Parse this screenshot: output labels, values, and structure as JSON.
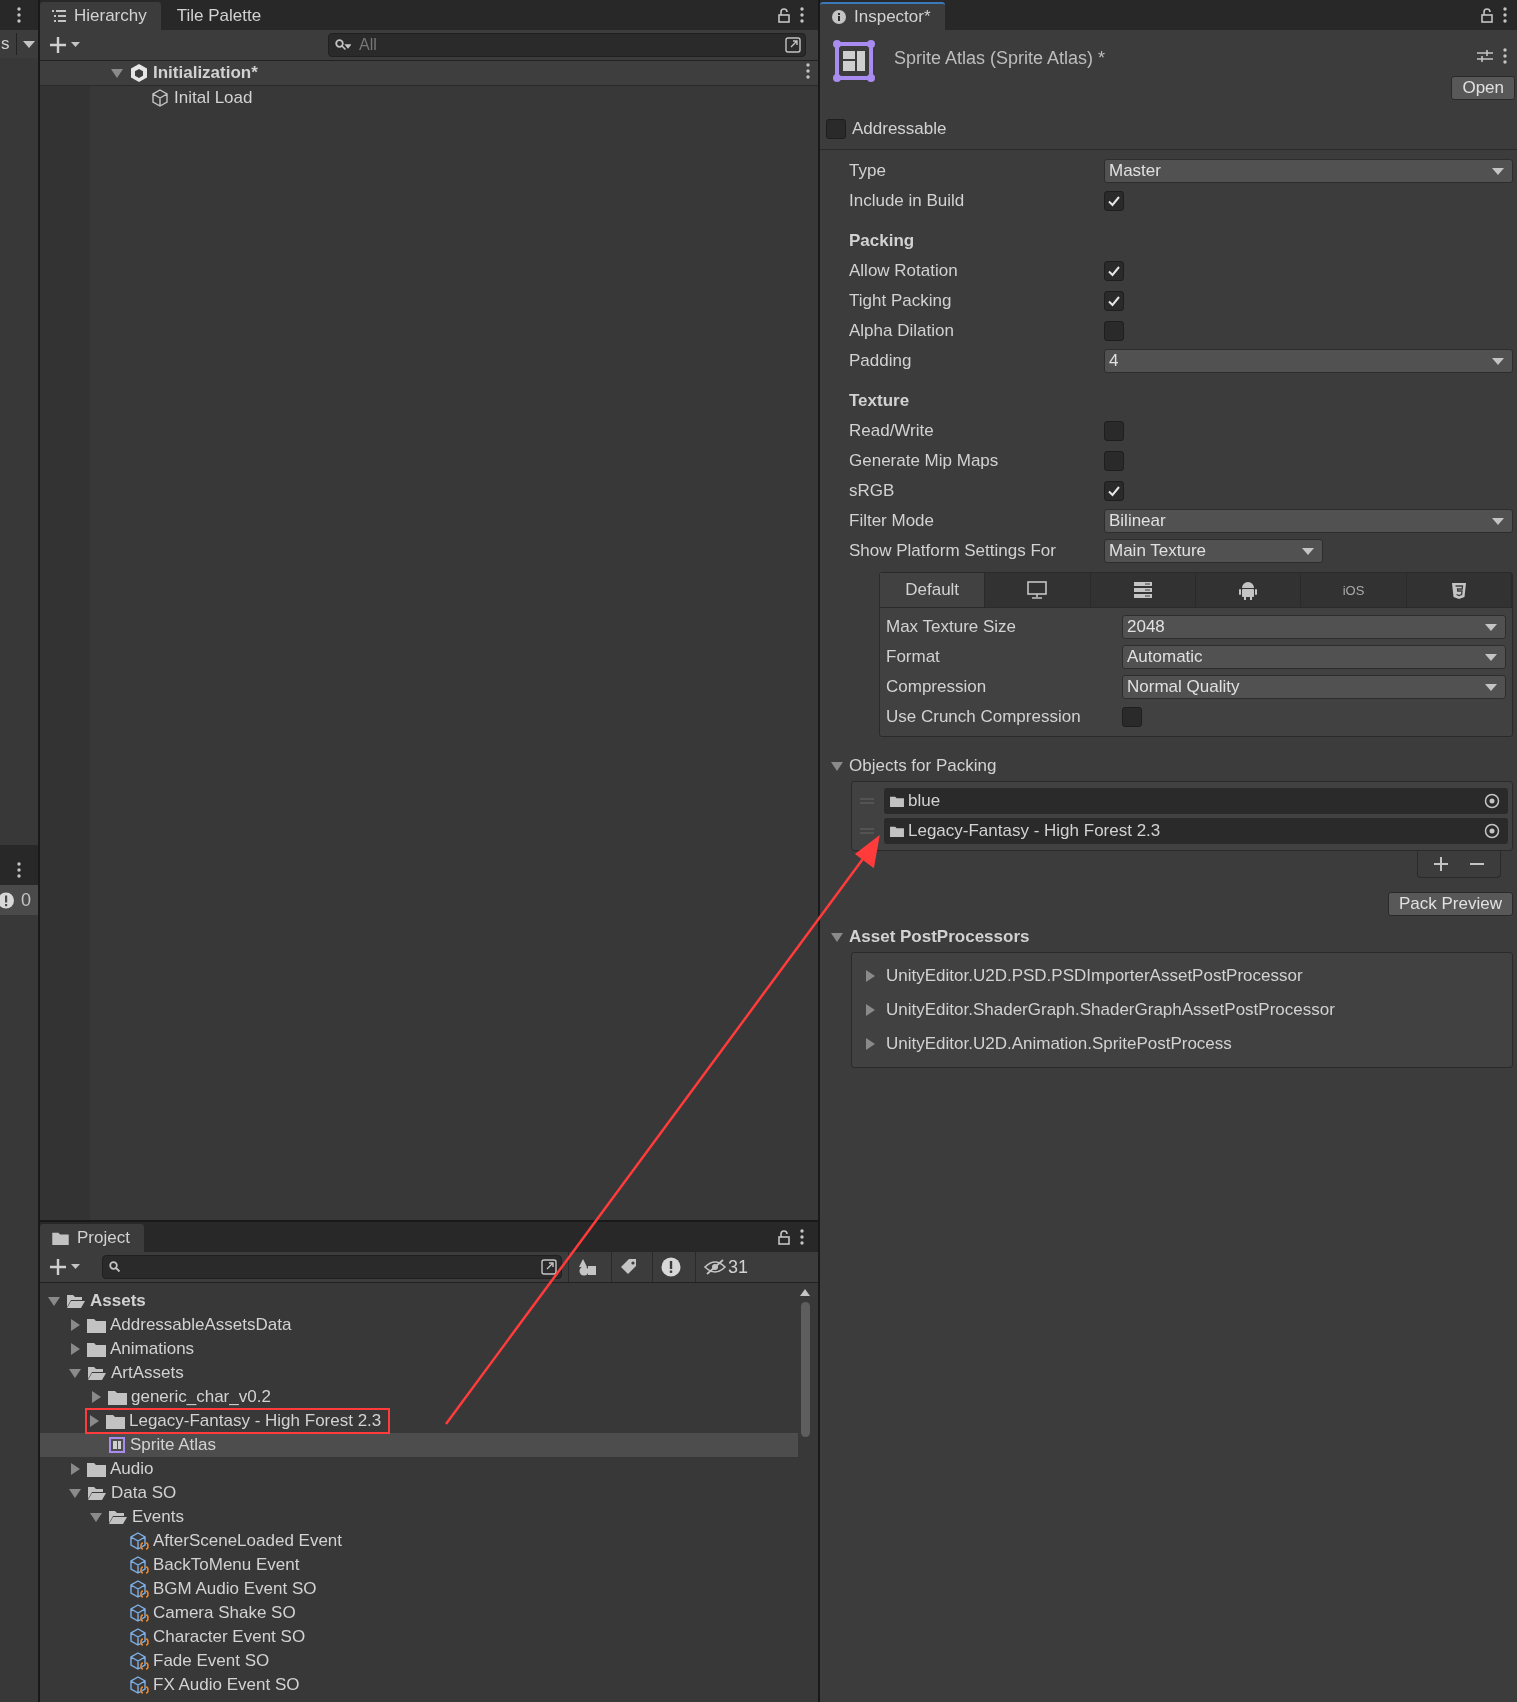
{
  "left_strip": {
    "toolbar_label": "s",
    "console_count": "0"
  },
  "hierarchy": {
    "tabs": [
      {
        "label": "Hierarchy",
        "selected": true
      },
      {
        "label": "Tile Palette",
        "selected": false
      }
    ],
    "search": {
      "placeholder": "All"
    },
    "tree": [
      {
        "label": "Initialization*",
        "kind": "scene",
        "expanded": true,
        "children": [
          {
            "label": "Inital Load",
            "kind": "object"
          }
        ]
      }
    ]
  },
  "project": {
    "tab": "Project",
    "hidden_count": "31",
    "tree": [
      {
        "label": "Assets",
        "kind": "folder",
        "bold": true,
        "expanded": true,
        "children": [
          {
            "label": "AddressableAssetsData",
            "kind": "folder",
            "expanded": false
          },
          {
            "label": "Animations",
            "kind": "folder",
            "expanded": false
          },
          {
            "label": "ArtAssets",
            "kind": "folder",
            "expanded": true,
            "children": [
              {
                "label": "generic_char_v0.2",
                "kind": "folder",
                "expanded": false
              },
              {
                "label": "Legacy-Fantasy - High Forest 2.3",
                "kind": "folder",
                "expanded": false,
                "highlighted": true
              },
              {
                "label": "Sprite Atlas",
                "kind": "atlas",
                "selected": true
              }
            ]
          },
          {
            "label": "Audio",
            "kind": "folder",
            "expanded": false
          },
          {
            "label": "Data SO",
            "kind": "folder",
            "expanded": true,
            "children": [
              {
                "label": "Events",
                "kind": "folder",
                "expanded": true,
                "children": [
                  {
                    "label": "AfterSceneLoaded Event",
                    "kind": "asset"
                  },
                  {
                    "label": "BackToMenu Event",
                    "kind": "asset"
                  },
                  {
                    "label": "BGM Audio Event SO",
                    "kind": "asset"
                  },
                  {
                    "label": "Camera Shake SO",
                    "kind": "asset"
                  },
                  {
                    "label": "Character Event SO",
                    "kind": "asset"
                  },
                  {
                    "label": "Fade Event SO",
                    "kind": "asset"
                  },
                  {
                    "label": "FX Audio Event SO",
                    "kind": "asset"
                  }
                ]
              }
            ]
          }
        ]
      }
    ]
  },
  "inspector": {
    "tab": "Inspector*",
    "title": "Sprite Atlas (Sprite Atlas) *",
    "open_button": "Open",
    "addressable": {
      "label": "Addressable",
      "checked": false
    },
    "properties": [
      {
        "kind": "dropdown",
        "label": "Type",
        "value": "Master"
      },
      {
        "kind": "checkbox",
        "label": "Include in Build",
        "checked": true
      },
      {
        "kind": "header",
        "label": "Packing"
      },
      {
        "kind": "checkbox",
        "label": "Allow Rotation",
        "checked": true
      },
      {
        "kind": "checkbox",
        "label": "Tight Packing",
        "checked": true
      },
      {
        "kind": "checkbox",
        "label": "Alpha Dilation",
        "checked": false
      },
      {
        "kind": "dropdown",
        "label": "Padding",
        "value": "4"
      },
      {
        "kind": "header",
        "label": "Texture"
      },
      {
        "kind": "checkbox",
        "label": "Read/Write",
        "checked": false
      },
      {
        "kind": "checkbox",
        "label": "Generate Mip Maps",
        "checked": false
      },
      {
        "kind": "checkbox",
        "label": "sRGB",
        "checked": true
      },
      {
        "kind": "dropdown",
        "label": "Filter Mode",
        "value": "Bilinear"
      },
      {
        "kind": "selector",
        "label": "Show Platform Settings For",
        "value": "Main Texture"
      }
    ],
    "platform_tabs": [
      {
        "kind": "text",
        "label": "Default",
        "selected": true
      },
      {
        "kind": "icon",
        "selected": false
      },
      {
        "kind": "icon",
        "selected": false
      },
      {
        "kind": "icon",
        "selected": false
      },
      {
        "kind": "text",
        "label": "iOS",
        "selected": false
      },
      {
        "kind": "icon",
        "selected": false
      }
    ],
    "platform_properties": [
      {
        "kind": "dropdown",
        "label": "Max Texture Size",
        "value": "2048"
      },
      {
        "kind": "dropdown",
        "label": "Format",
        "value": "Automatic"
      },
      {
        "kind": "dropdown",
        "label": "Compression",
        "value": "Normal Quality"
      },
      {
        "kind": "checkbox",
        "label": "Use Crunch Compression",
        "checked": false
      }
    ],
    "objects_for_packing": {
      "title": "Objects for Packing",
      "expanded": true,
      "items": [
        "blue",
        "Legacy-Fantasy - High Forest 2.3"
      ]
    },
    "pack_preview_button": "Pack Preview",
    "post_processors": {
      "title": "Asset PostProcessors",
      "expanded": true,
      "items": [
        "UnityEditor.U2D.PSD.PSDImporterAssetPostProcessor",
        "UnityEditor.ShaderGraph.ShaderGraphAssetPostProcessor",
        "UnityEditor.U2D.Animation.SpritePostProcess"
      ]
    }
  }
}
